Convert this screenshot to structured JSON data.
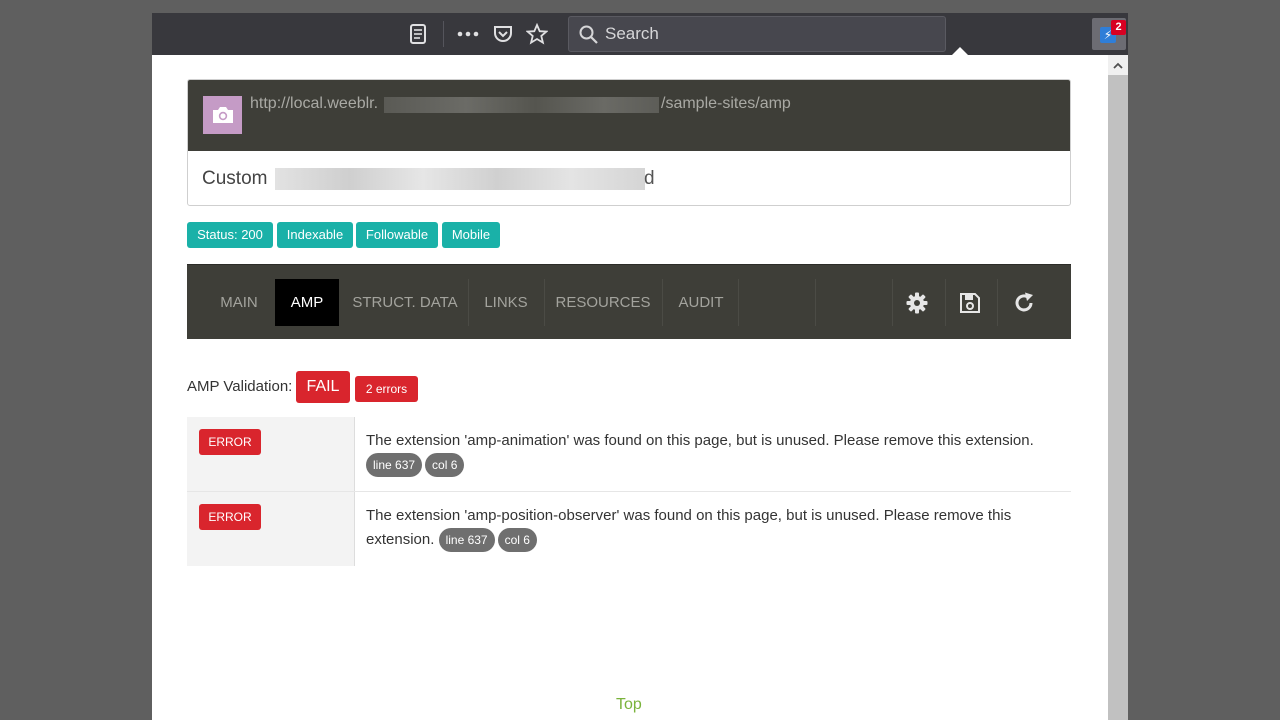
{
  "browser": {
    "search_placeholder": "Search",
    "extension_badge": "2"
  },
  "page": {
    "url_prefix": "http://local.weeblr.",
    "url_suffix": "/sample-sites/amp",
    "title_prefix": "Custom",
    "title_suffix": "d"
  },
  "status_chips": [
    "Status: 200",
    "Indexable",
    "Followable",
    "Mobile"
  ],
  "tabs": [
    "MAIN",
    "AMP",
    "STRUCT. DATA",
    "LINKS",
    "RESOURCES",
    "AUDIT"
  ],
  "active_tab": "AMP",
  "validation": {
    "label": "AMP Validation:",
    "result": "FAIL",
    "error_count": "2 errors"
  },
  "errors": [
    {
      "level": "ERROR",
      "message": "The extension 'amp-animation' was found on this page, but is unused. Please remove this extension.",
      "line": "line 637",
      "col": "col 6"
    },
    {
      "level": "ERROR",
      "message": "The extension 'amp-position-observer' was found on this page, but is unused. Please remove this extension.",
      "line": "line 637",
      "col": "col 6"
    }
  ],
  "footer": {
    "top_link": "Top"
  },
  "colors": {
    "teal": "#1ab1a8",
    "error_red": "#d9252d",
    "dark_bar": "#3e3e38",
    "link_green": "#7ab33b"
  }
}
